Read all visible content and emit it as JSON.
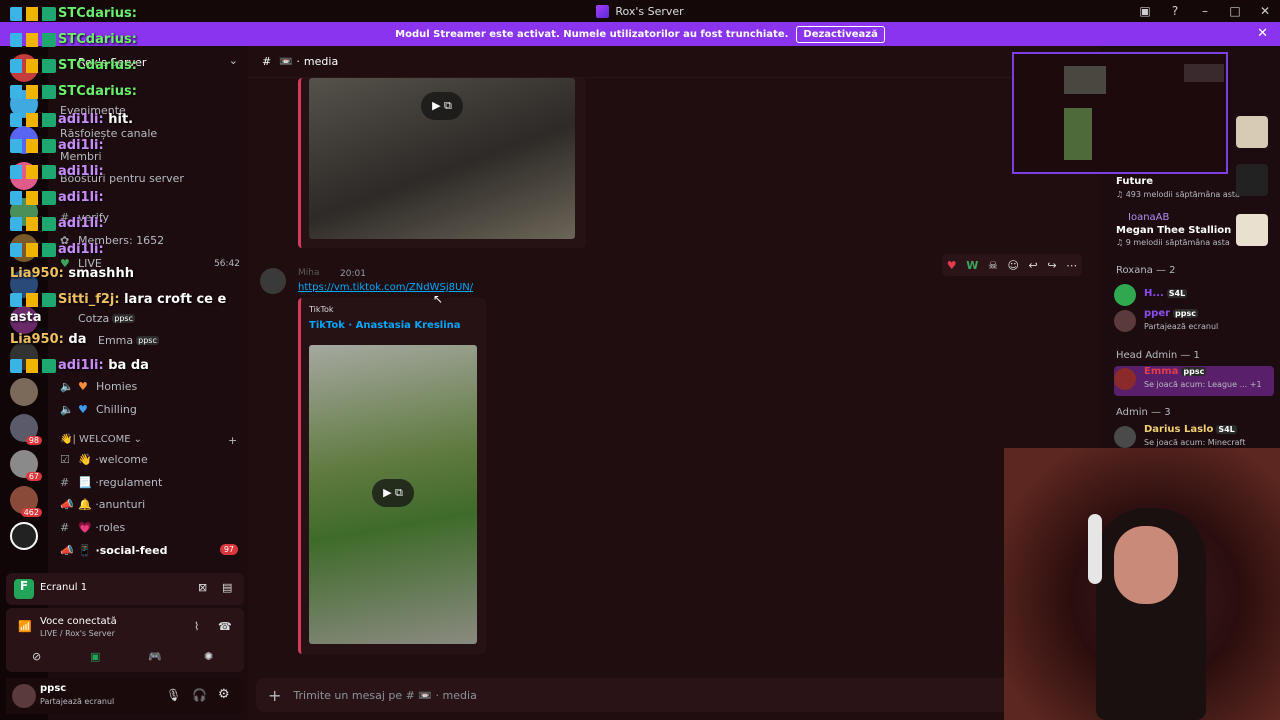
{
  "window": {
    "title": "Rox's Server"
  },
  "banner": {
    "text": "Modul Streamer este activat. Numele utilizatorilor au fost trunchiate.",
    "button": "Dezactivează"
  },
  "server": {
    "name": "Rox's Server"
  },
  "server_list": {
    "badges": [
      "98",
      "67",
      "462"
    ]
  },
  "channels": {
    "top": [
      "Evenimente",
      "Răsfoiește canale",
      "Membri",
      "Boosturi pentru server"
    ],
    "verify": "verify",
    "members_count": "Members: 1652",
    "live": {
      "name": "LIVE",
      "time": "56:42"
    },
    "voice_users": [
      {
        "name": "Cotza",
        "tag": "ppsc"
      },
      {
        "name": "Emma",
        "tag": "ppsc"
      }
    ],
    "voice_channels": [
      "Homies",
      "Chilling"
    ],
    "category": "| WELCOME",
    "text_channels": [
      {
        "name": "welcome"
      },
      {
        "name": "regulament"
      },
      {
        "name": "anunturi"
      },
      {
        "name": "roles"
      },
      {
        "name": "social-feed",
        "mention": "97"
      }
    ]
  },
  "screen_share": {
    "label": "Ecranul 1"
  },
  "voice": {
    "status": "Voce conectată",
    "channel": "LIVE / Rox's Server"
  },
  "user": {
    "name": "ppsc",
    "status": "Partajează ecranul"
  },
  "main": {
    "channel_name": "media",
    "message": {
      "author": "Miha",
      "time": "20:01",
      "link": "https://vm.tiktok.com/ZNdWSj8UN/"
    },
    "embed": {
      "provider": "TikTok",
      "title": "TikTok · Anastasia Kreslina"
    },
    "composer_placeholder": "Trimite un mesaj pe #",
    "composer_channel": "media"
  },
  "members": {
    "activity_items": [
      {
        "name": "Future",
        "status": "493 melodii săptămâna asta"
      },
      {
        "name": "IoanaAB",
        "title": "Megan Thee Stallion",
        "status": "9 melodii săptămâna asta"
      }
    ],
    "groups": [
      {
        "heading": "Roxana — 2",
        "rows": [
          {
            "name": "H...",
            "tag": "S4L",
            "status": ""
          },
          {
            "name": "pper",
            "tag": "ppsc",
            "status": "Partajează ecranul"
          }
        ]
      },
      {
        "heading": "Head Admin — 1",
        "rows": [
          {
            "name": "Emma",
            "tag": "ppsc",
            "status": "Se joacă acum: League ... +1"
          }
        ]
      },
      {
        "heading": "Admin — 3",
        "rows": [
          {
            "name": "Darius Laslo",
            "tag": "S4L",
            "status": "Se joacă acum: Minecraft"
          }
        ]
      }
    ]
  },
  "chat_overlay": [
    {
      "user": "STCdarius:",
      "text": ""
    },
    {
      "user": "STCdarius:",
      "text": ""
    },
    {
      "user": "STCdarius:",
      "text": ""
    },
    {
      "user": "STCdarius:",
      "text": ""
    },
    {
      "user": "adi1li:",
      "text": "hit."
    },
    {
      "user": "adi1li:",
      "text": ""
    },
    {
      "user": "adi1li:",
      "text": ""
    },
    {
      "user": "adi1li:",
      "text": ""
    },
    {
      "user": "adi1li:",
      "text": ""
    },
    {
      "user": "adi1li:",
      "text": ""
    },
    {
      "user": "Lia950:",
      "text": "smashhh"
    },
    {
      "user": "Sitti_f2j:",
      "text": "lara croft ce e"
    },
    {
      "user": "",
      "text": "asta"
    },
    {
      "user": "Lia950:",
      "text": "da"
    },
    {
      "user": "adi1li:",
      "text": "ba da"
    }
  ]
}
